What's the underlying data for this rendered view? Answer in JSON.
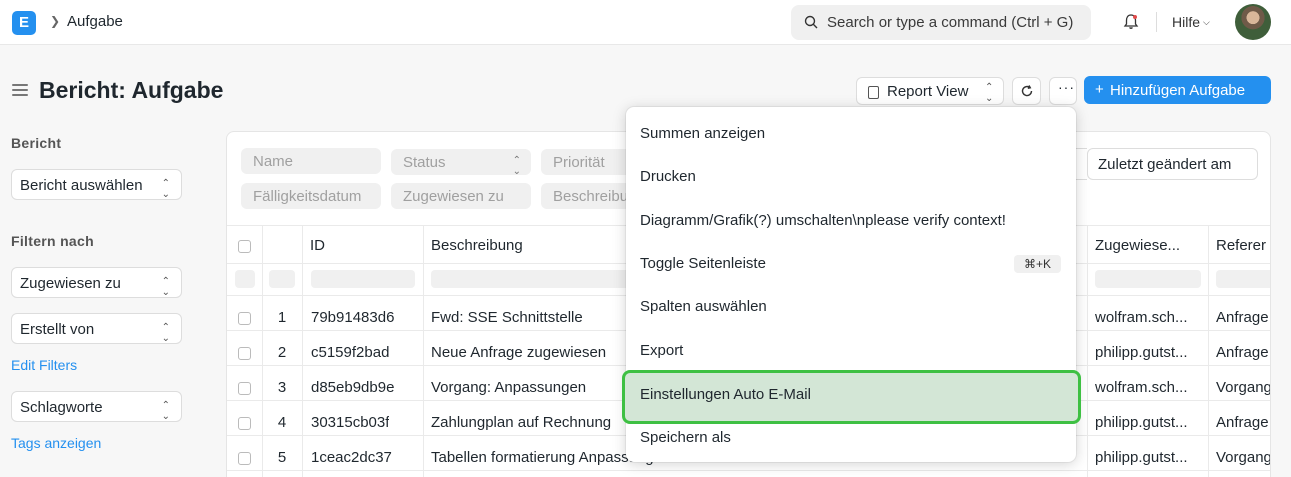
{
  "navbar": {
    "logo_letter": "E",
    "breadcrumb": "Aufgabe",
    "search_placeholder": "Search or type a command (Ctrl + G)",
    "help_label": "Hilfe"
  },
  "header": {
    "title": "Bericht: Aufgabe",
    "report_view_label": "Report View",
    "more_label": "···",
    "add_button_label": "Hinzufügen Aufgabe"
  },
  "sidebar": {
    "report_section_label": "Bericht",
    "report_select": "Bericht auswählen",
    "filter_section_label": "Filtern nach",
    "filter_assigned": "Zugewiesen zu",
    "filter_created_by": "Erstellt von",
    "edit_filters_link": "Edit Filters",
    "tags_select": "Schlagworte",
    "show_tags_link": "Tags anzeigen"
  },
  "filters": {
    "name": "Name",
    "status": "Status",
    "priority": "Priorität",
    "due_date": "Fälligkeitsdatum",
    "assigned_to": "Zugewiesen zu",
    "description": "Beschreibung",
    "sort_label": "Zuletzt geändert am"
  },
  "table": {
    "headers": [
      "ID",
      "Beschreibung",
      "Zugewiese...",
      "Referer"
    ],
    "rows": [
      {
        "num": "1",
        "id": "79b91483d6",
        "desc": "Fwd: SSE Schnittstelle",
        "assignee": "wolfram.sch...",
        "ref": "Anfrage"
      },
      {
        "num": "2",
        "id": "c5159f2bad",
        "desc": "Neue Anfrage zugewiesen",
        "assignee": "philipp.gutst...",
        "ref": "Anfrage"
      },
      {
        "num": "3",
        "id": "d85eb9db9e",
        "desc": "Vorgang: Anpassungen",
        "assignee": "wolfram.sch...",
        "ref": "Vorgang"
      },
      {
        "num": "4",
        "id": "30315cb03f",
        "desc": "Zahlungplan auf Rechnung",
        "assignee": "philipp.gutst...",
        "ref": "Anfrage"
      },
      {
        "num": "5",
        "id": "1ceac2dc37",
        "desc": "Tabellen formatierung Anpassungen",
        "assignee": "philipp.gutst...",
        "ref": "Vorgang"
      }
    ]
  },
  "menu": {
    "items": [
      "Summen anzeigen",
      "Drucken",
      "Diagramm/Grafik(?) umschalten\\nplease verify context!",
      "Toggle Seitenleiste",
      "Spalten auswählen",
      "Export",
      "Einstellungen Auto E-Mail",
      "Speichern als"
    ],
    "shortcut": "⌘+K"
  },
  "colors": {
    "primary": "#2490ef",
    "highlight_bg": "#d3e6d6",
    "highlight_border": "#3ec043"
  }
}
